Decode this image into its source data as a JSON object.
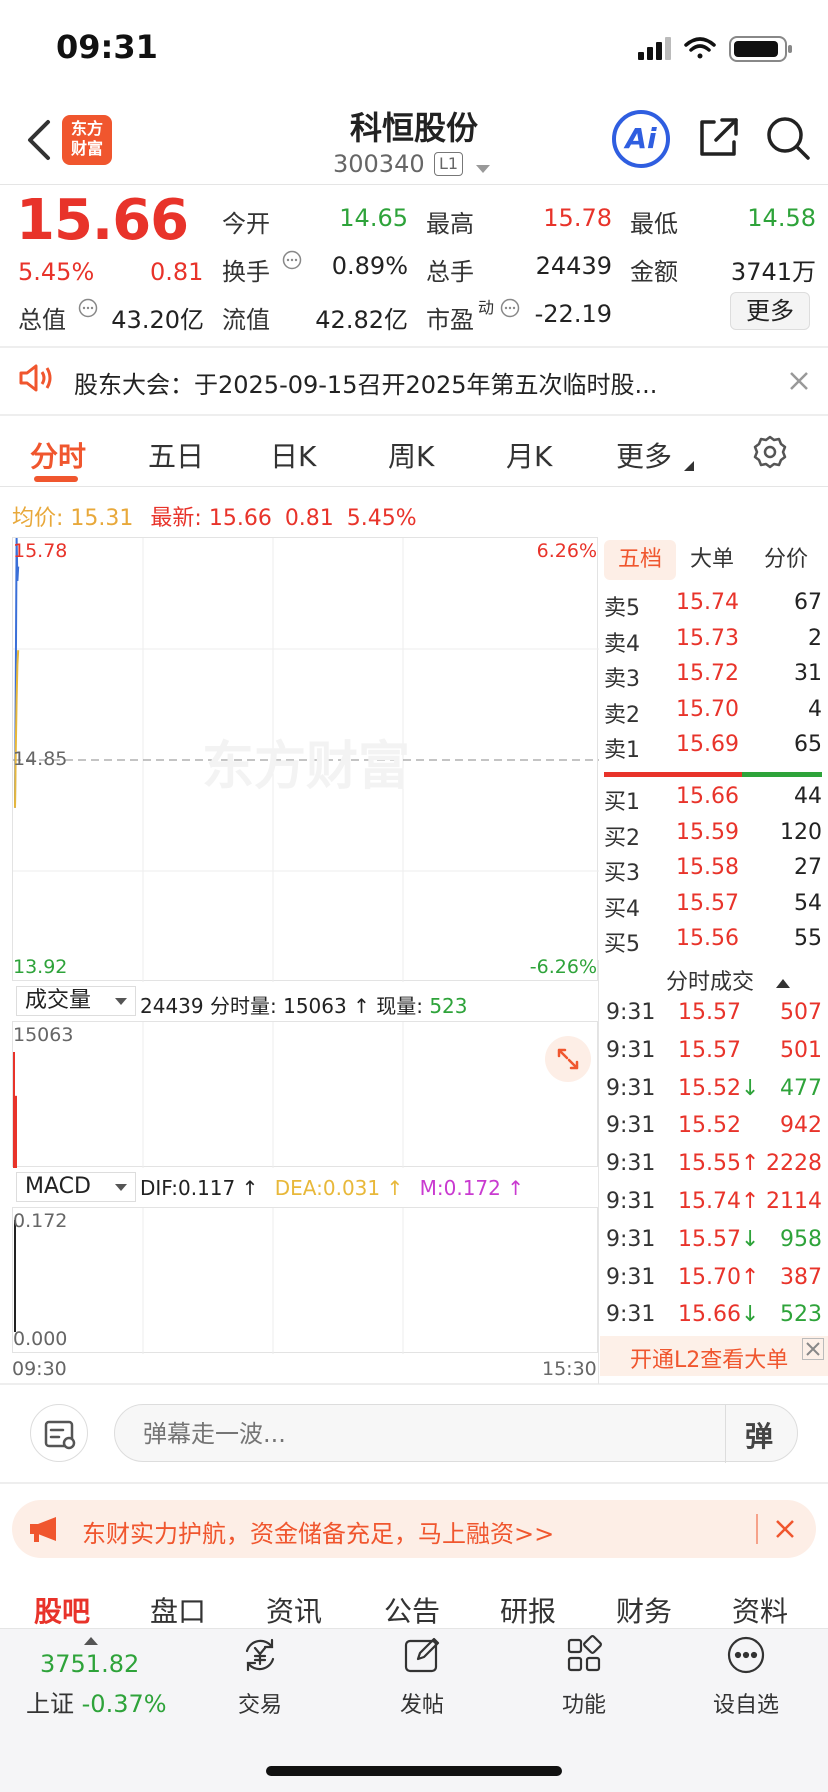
{
  "status": {
    "time": "09:31"
  },
  "header": {
    "title": "科恒股份",
    "code": "300340",
    "level": "L1",
    "logo_line1": "东方",
    "logo_line2": "财富",
    "ai_label": "Ai"
  },
  "quote": {
    "price": "15.66",
    "change_pct": "5.45%",
    "change": "0.81",
    "open_label": "今开",
    "open": "14.65",
    "high_label": "最高",
    "high": "15.78",
    "low_label": "最低",
    "low": "14.58",
    "turnover_label": "换手",
    "turnover": "0.89%",
    "volume_label": "总手",
    "volume": "24439",
    "amount_label": "金额",
    "amount": "3741万",
    "mktcap_label": "总值",
    "mktcap": "43.20亿",
    "float_label": "流值",
    "float": "42.82亿",
    "pe_label": "市盈",
    "pe_sup": "动",
    "pe": "-22.19",
    "more_label": "更多"
  },
  "notice": {
    "text": "股东大会：于2025-09-15召开2025年第五次临时股..."
  },
  "tabs": [
    "分时",
    "五日",
    "日K",
    "周K",
    "月K",
    "更多"
  ],
  "chart_info": {
    "avg_label": "均价:",
    "avg": "15.31",
    "latest_label": "最新:",
    "latest": "15.66",
    "latest_change": "0.81",
    "latest_pct": "5.45%"
  },
  "chart_data": [
    {
      "type": "line",
      "y_max": "15.78",
      "y_mid": "14.85",
      "y_min": "13.92",
      "pct_max": "6.26%",
      "pct_min": "-6.26%",
      "watermark": "东方财富",
      "ylim": [
        13.92,
        15.78
      ],
      "x_start": "09:30",
      "x_end": "15:30",
      "series": [
        {
          "values": [
            14.65,
            15.2,
            15.78,
            15.6,
            15.66
          ],
          "color": "#3a6fd8"
        },
        {
          "values": [
            14.65,
            14.9,
            15.1,
            15.25,
            15.31
          ],
          "color": "#e8b83a"
        }
      ]
    },
    {
      "type": "bar",
      "selector": "成交量",
      "total": "24439",
      "minute_label": "分时量:",
      "minute_vol": "15063",
      "now_label": "现量:",
      "now_vol": "523",
      "y_max": "15063",
      "values": [
        15063,
        9373
      ]
    },
    {
      "type": "bar",
      "selector": "MACD",
      "dif_label": "DIF:",
      "dif": "0.117",
      "dea_label": "DEA:",
      "dea": "0.031",
      "m_label": "M:",
      "m": "0.172",
      "y_max": "0.172",
      "y_min": "0.000",
      "x_start": "09:30",
      "x_end": "15:30",
      "values": [
        0.172
      ]
    }
  ],
  "orderbook": {
    "tabs": [
      "五档",
      "大单",
      "分价"
    ],
    "asks": [
      {
        "label": "卖5",
        "price": "15.74",
        "vol": "67"
      },
      {
        "label": "卖4",
        "price": "15.73",
        "vol": "2"
      },
      {
        "label": "卖3",
        "price": "15.72",
        "vol": "31"
      },
      {
        "label": "卖2",
        "price": "15.70",
        "vol": "4"
      },
      {
        "label": "卖1",
        "price": "15.69",
        "vol": "65"
      }
    ],
    "bids": [
      {
        "label": "买1",
        "price": "15.66",
        "vol": "44"
      },
      {
        "label": "买2",
        "price": "15.59",
        "vol": "120"
      },
      {
        "label": "买3",
        "price": "15.58",
        "vol": "27"
      },
      {
        "label": "买4",
        "price": "15.57",
        "vol": "54"
      },
      {
        "label": "买5",
        "price": "15.56",
        "vol": "55"
      }
    ],
    "trades_title": "分时成交",
    "trades": [
      {
        "time": "9:31",
        "price": "15.57",
        "arrow": "",
        "vol": "507",
        "dir": "up"
      },
      {
        "time": "9:31",
        "price": "15.57",
        "arrow": "",
        "vol": "501",
        "dir": "up"
      },
      {
        "time": "9:31",
        "price": "15.52",
        "arrow": "↓",
        "vol": "477",
        "dir": "down"
      },
      {
        "time": "9:31",
        "price": "15.52",
        "arrow": "",
        "vol": "942",
        "dir": "up"
      },
      {
        "time": "9:31",
        "price": "15.55",
        "arrow": "↑",
        "vol": "2228",
        "dir": "up"
      },
      {
        "time": "9:31",
        "price": "15.74",
        "arrow": "↑",
        "vol": "2114",
        "dir": "up"
      },
      {
        "time": "9:31",
        "price": "15.57",
        "arrow": "↓",
        "vol": "958",
        "dir": "down"
      },
      {
        "time": "9:31",
        "price": "15.70",
        "arrow": "↑",
        "vol": "387",
        "dir": "up"
      },
      {
        "time": "9:31",
        "price": "15.66",
        "arrow": "↓",
        "vol": "523",
        "dir": "down"
      }
    ],
    "l2_banner": "开通L2查看大单"
  },
  "danmu": {
    "placeholder": "弹幕走一波...",
    "btn": "弹"
  },
  "promo": {
    "text": "东财实力护航，资金储备充足，马上融资>>"
  },
  "bottom_tabs": [
    "股吧",
    "盘口",
    "资讯",
    "公告",
    "研报",
    "财务",
    "资料"
  ],
  "nav": {
    "index_value": "3751.82",
    "index_name": "上证",
    "index_pct": "-0.37%",
    "items": [
      "交易",
      "发帖",
      "功能",
      "设自选"
    ]
  },
  "colors": {
    "up": "#e8332a",
    "down": "#2ea33a",
    "accent": "#f0562e",
    "ai": "#2f5ee0"
  }
}
